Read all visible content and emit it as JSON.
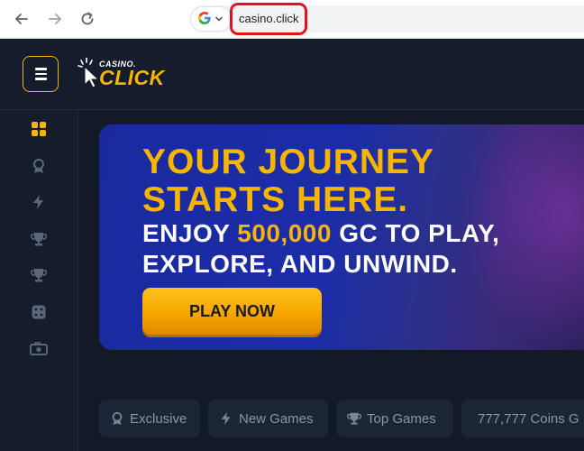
{
  "browser": {
    "url": "casino.click",
    "site_info_icon": "google-g-icon"
  },
  "header": {
    "logo_top": "CASINO.",
    "logo_main": "CLICK"
  },
  "sidebar": {
    "items": [
      {
        "icon": "grid-icon",
        "color": "#f5b400"
      },
      {
        "icon": "ribbon-icon"
      },
      {
        "icon": "lightning-icon"
      },
      {
        "icon": "trophy-icon"
      },
      {
        "icon": "trophy-icon"
      },
      {
        "icon": "dice-icon"
      },
      {
        "icon": "cash-icon"
      }
    ]
  },
  "hero": {
    "line1": "YOUR JOURNEY",
    "line2": "STARTS HERE.",
    "sub1_prefix": "ENJOY ",
    "sub1_highlight": "500,000",
    "sub1_suffix": " GC TO PLAY,",
    "sub2": "EXPLORE, AND UNWIND.",
    "cta": "PLAY NOW"
  },
  "categories": [
    {
      "label": "Exclusive",
      "icon": "ribbon-icon"
    },
    {
      "label": "New Games",
      "icon": "lightning-icon"
    },
    {
      "label": "Top Games",
      "icon": "trophy-icon"
    },
    {
      "label": "777,777 Coins G",
      "icon": "trophy-icon"
    }
  ],
  "colors": {
    "accent": "#f5b400",
    "background": "#151d2c",
    "hero_blue": "#1b2ca8",
    "highlight_red": "#e3121b"
  }
}
